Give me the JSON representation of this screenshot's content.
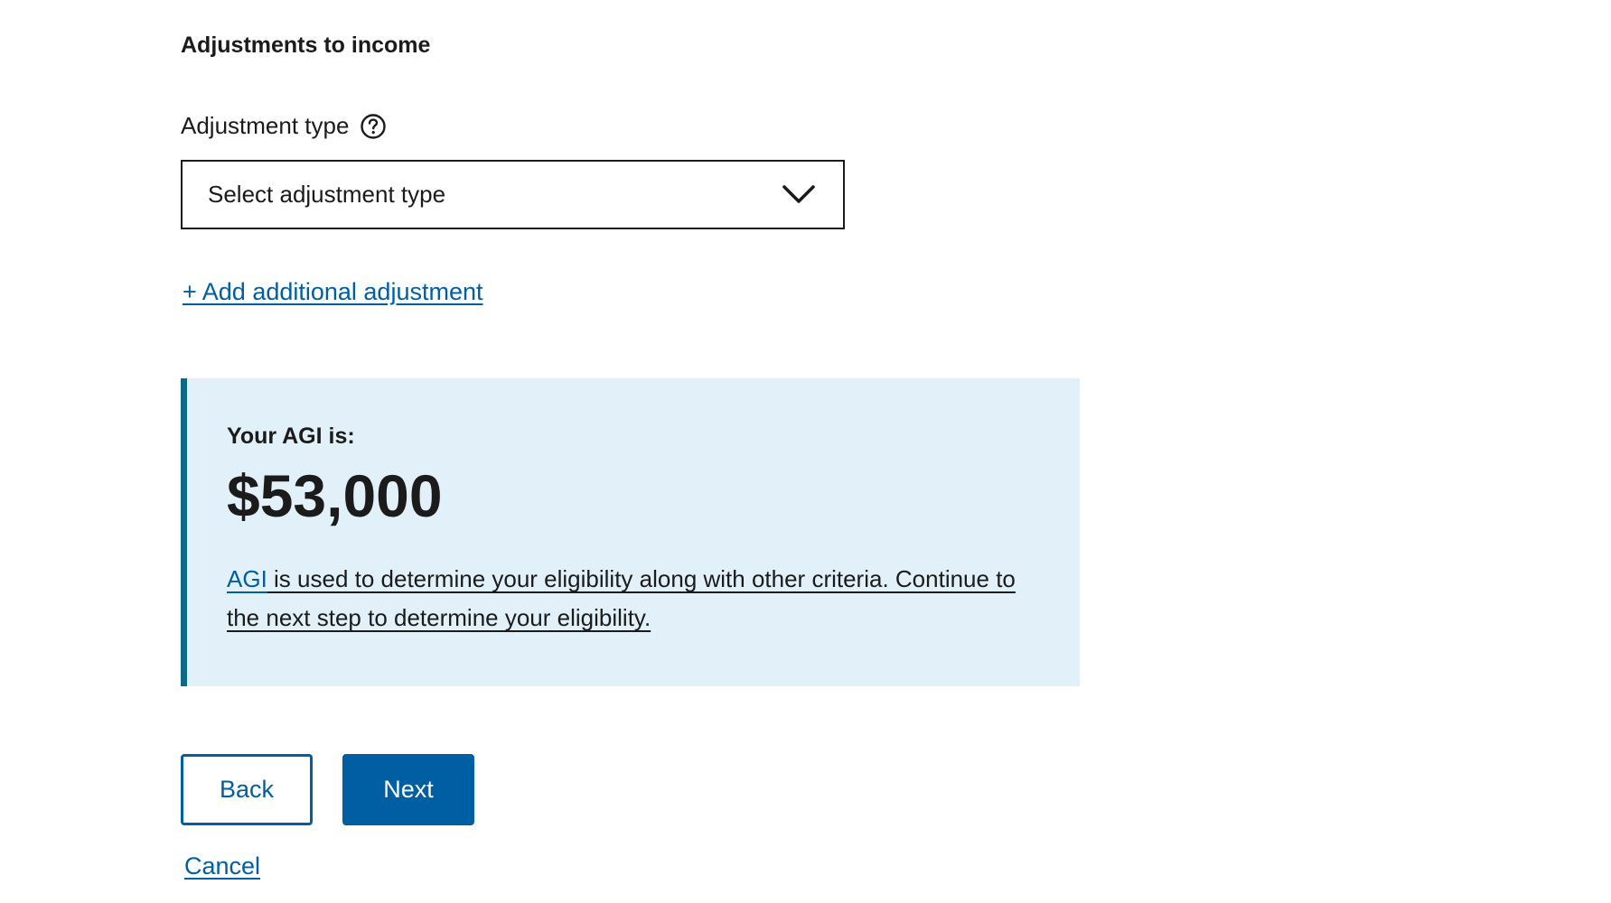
{
  "section": {
    "title": "Adjustments to income"
  },
  "adjustment_field": {
    "label": "Adjustment type",
    "help_icon": "question-circle-icon",
    "selected_value": "Select adjustment type",
    "dropdown_icon": "chevron-down-icon"
  },
  "add_adjustment_link": "+ Add additional adjustment",
  "summary": {
    "label": "Your AGI is:",
    "value": "$53,000",
    "note_link": "AGI",
    "note_text": " is used to determine your eligibility along with other criteria. Continue to the next step to determine your eligibility."
  },
  "actions": {
    "back_label": "Back",
    "next_label": "Next",
    "cancel_label": "Cancel"
  },
  "colors": {
    "link": "#005ea2",
    "primary_button": "#005ea2",
    "summary_background": "#e1f0f9",
    "summary_border": "#0b6b87",
    "text": "#1b1b1b"
  }
}
